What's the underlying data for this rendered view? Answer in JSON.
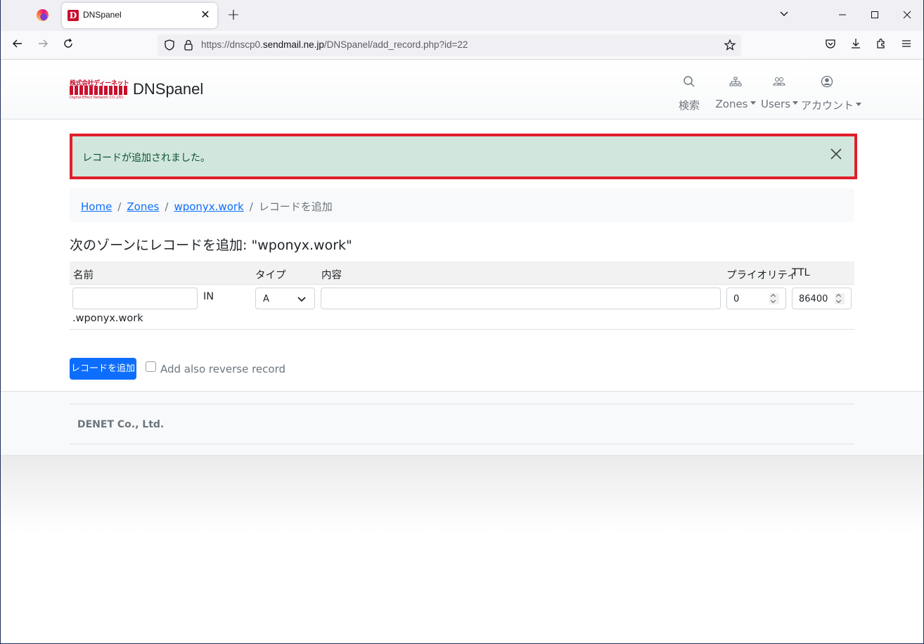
{
  "browser": {
    "tab_title": "DNSpanel",
    "url_prefix": "https://dnscp0.",
    "url_domain": "sendmail.ne.jp",
    "url_path": "/DNSpanel/add_record.php?id=22"
  },
  "header": {
    "brand": "DNSpanel",
    "logo_top": "株式会社ディーネット",
    "logo_bottom": "Digital-Effect Network CO.,LTD.",
    "nav": {
      "search": "検索",
      "zones": "Zones",
      "users": "Users",
      "account": "アカウント"
    }
  },
  "alert": {
    "message": "レコードが追加されました。",
    "color": "#d1e7dd"
  },
  "breadcrumb": {
    "home": "Home",
    "zones": "Zones",
    "zone": "wponyx.work",
    "current": "レコードを追加"
  },
  "page_title": "次のゾーンにレコードを追加: \"wponyx.work\"",
  "table": {
    "headers": {
      "name": "名前",
      "type": "タイプ",
      "content": "内容",
      "priority": "プライオリティ",
      "ttl": "TTL"
    },
    "row": {
      "name_value": "",
      "in_label": "IN",
      "zone_suffix": ".wponyx.work",
      "type_value": "A",
      "content_value": "",
      "priority_value": "0",
      "ttl_value": "86400"
    }
  },
  "actions": {
    "add_button": "レコードを追加",
    "reverse_checkbox_label": "Add also reverse record",
    "reverse_checked": false
  },
  "footer": {
    "company": "DENET Co., Ltd."
  },
  "colors": {
    "primary": "#0d6efd",
    "alert_border": "#e0202a",
    "brand_red": "#c8102e"
  }
}
